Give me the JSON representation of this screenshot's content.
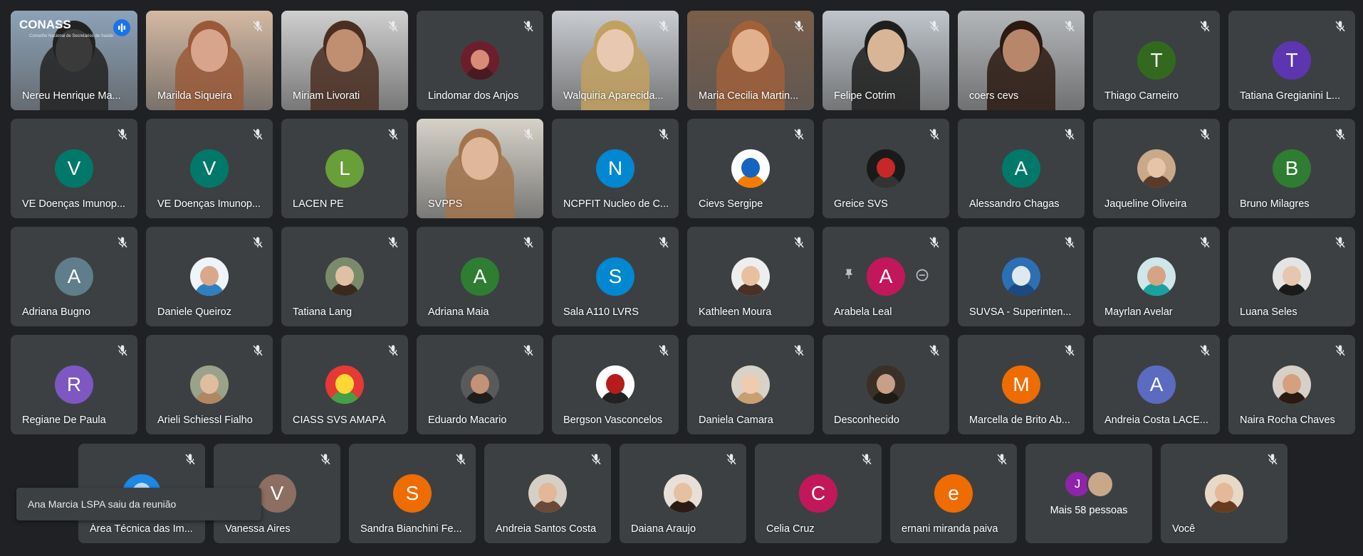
{
  "toast": "Ana Marcia LSPA saiu da reunião",
  "more_label": "Mais 58 pessoas",
  "conass": {
    "logo": "CONASS",
    "sub": "Conselho Nacional de Secretários de Saúde"
  },
  "participants": [
    {
      "name": "Nereu Henrique Ma...",
      "type": "video",
      "bg": "#8da2b8",
      "skin": "#3a3a3a",
      "hair": "#222",
      "active": true
    },
    {
      "name": "Marilda Siqueira",
      "type": "video",
      "bg": "#d4b9a3",
      "skin": "#d8a58c",
      "hair": "#9a5a3a"
    },
    {
      "name": "Miriam Livorati",
      "type": "video",
      "bg": "#cfcfcf",
      "skin": "#c08f72",
      "hair": "#4a2e22"
    },
    {
      "name": "Lindomar dos Anjos",
      "type": "photo",
      "c1": "#6c1e2d",
      "c2": "#d98b7a",
      "c3": "#4a1a22"
    },
    {
      "name": "Walquiria Aparecida...",
      "type": "video",
      "bg": "#c9ccd1",
      "skin": "#e8c8b0",
      "hair": "#c2a060"
    },
    {
      "name": "Maria Cecilia Martin...",
      "type": "video",
      "bg": "#7a5e4a",
      "skin": "#e3b08e",
      "hair": "#a0603a"
    },
    {
      "name": "Felipe Cotrim",
      "type": "video",
      "bg": "#bfc5cb",
      "skin": "#d9b597",
      "hair": "#1e1e1e"
    },
    {
      "name": "coers cevs",
      "type": "video",
      "bg": "#b4b7ba",
      "skin": "#b8866a",
      "hair": "#2b1a12"
    },
    {
      "name": "Thiago Carneiro",
      "type": "letter",
      "letter": "T",
      "color": "#33691e"
    },
    {
      "name": "Tatiana Gregianini L...",
      "type": "letter",
      "letter": "T",
      "color": "#5e35b1"
    },
    {
      "name": "VE Doenças Imunop...",
      "type": "letter",
      "letter": "V",
      "color": "#00796b"
    },
    {
      "name": "VE Doenças Imunop...",
      "type": "letter",
      "letter": "V",
      "color": "#00796b"
    },
    {
      "name": "LACEN PE",
      "type": "letter",
      "letter": "L",
      "color": "#689f38"
    },
    {
      "name": "SVPPS",
      "type": "video",
      "bg": "#d6d2c8",
      "skin": "#e0b79a",
      "hair": "#a3744e"
    },
    {
      "name": "NCPFIT Nucleo de C...",
      "type": "letter",
      "letter": "N",
      "color": "#0288d1"
    },
    {
      "name": "Cievs Sergipe",
      "type": "photo",
      "c1": "#ffffff",
      "c2": "#1565c0",
      "c3": "#f57c00"
    },
    {
      "name": "Greice SVS",
      "type": "photo",
      "c1": "#1a1a1a",
      "c2": "#c62828",
      "c3": "#333"
    },
    {
      "name": "Alessandro Chagas",
      "type": "letter",
      "letter": "A",
      "color": "#00796b"
    },
    {
      "name": "Jaqueline Oliveira",
      "type": "photo",
      "c1": "#c9a98a",
      "c2": "#e6c4a8",
      "c3": "#5a3a2a"
    },
    {
      "name": "Bruno Milagres",
      "type": "letter",
      "letter": "B",
      "color": "#2e7d32"
    },
    {
      "name": "Adriana Bugno",
      "type": "letter",
      "letter": "A",
      "color": "#607d8b"
    },
    {
      "name": "Daniele Queiroz",
      "type": "photo",
      "c1": "#eef4fa",
      "c2": "#d9a88a",
      "c3": "#2f7fc1"
    },
    {
      "name": "Tatiana Lang",
      "type": "photo",
      "c1": "#7c8a6c",
      "c2": "#e0c0a4",
      "c3": "#3a2a1e"
    },
    {
      "name": "Adriana Maia",
      "type": "letter",
      "letter": "A",
      "color": "#2e7d32"
    },
    {
      "name": "Sala A110 LVRS",
      "type": "letter",
      "letter": "S",
      "color": "#0288d1"
    },
    {
      "name": "Kathleen Moura",
      "type": "photo",
      "c1": "#eeeeee",
      "c2": "#e8c0a0",
      "c3": "#4a3026"
    },
    {
      "name": "Arabela Leal",
      "type": "letter",
      "letter": "A",
      "color": "#c2185b",
      "hover": true
    },
    {
      "name": "SUVSA - Superinten...",
      "type": "photo",
      "c1": "#2d6fb3",
      "c2": "#dfe7ef",
      "c3": "#1a4a80"
    },
    {
      "name": "Mayrlan Avelar",
      "type": "photo",
      "c1": "#cfe6ea",
      "c2": "#d6a484",
      "c3": "#16a3a0"
    },
    {
      "name": "Luana Seles",
      "type": "photo",
      "c1": "#e4e4e4",
      "c2": "#e6c6ae",
      "c3": "#1a1a1a"
    },
    {
      "name": "Regiane De Paula",
      "type": "letter",
      "letter": "R",
      "color": "#7e57c2"
    },
    {
      "name": "Arieli Schiessl Fialho",
      "type": "photo",
      "c1": "#9aa28a",
      "c2": "#e0bca0",
      "c3": "#b08860"
    },
    {
      "name": "CIASS SVS AMAPÁ",
      "type": "photo",
      "c1": "#e53935",
      "c2": "#fdd835",
      "c3": "#43a047"
    },
    {
      "name": "Eduardo Macario",
      "type": "photo",
      "c1": "#5a5a5a",
      "c2": "#c49274",
      "c3": "#1e1e1e"
    },
    {
      "name": "Bergson Vasconcelos",
      "type": "photo",
      "c1": "#ffffff",
      "c2": "#b71c1c",
      "c3": "#222"
    },
    {
      "name": "Daniela Camara",
      "type": "photo",
      "c1": "#d8d2c8",
      "c2": "#f0cbb0",
      "c3": "#c8a070"
    },
    {
      "name": "Desconhecido",
      "type": "photo",
      "c1": "#3a3028",
      "c2": "#c8a088",
      "c3": "#1e1a16"
    },
    {
      "name": "Marcella de Brito Ab...",
      "type": "letter",
      "letter": "M",
      "color": "#ef6c00"
    },
    {
      "name": "Andreia Costa LACE...",
      "type": "letter",
      "letter": "A",
      "color": "#5c6bc0"
    },
    {
      "name": "Naira Rocha Chaves",
      "type": "photo",
      "c1": "#d8d0c8",
      "c2": "#d4a080",
      "c3": "#2a1a12"
    },
    {
      "name": "Área Técnica das Im...",
      "type": "photo",
      "c1": "#1e88e5",
      "c2": "#bbdefb",
      "c3": "#0d47a1"
    },
    {
      "name": "Vanessa Aires",
      "type": "letter",
      "letter": "V",
      "color": "#8d6e63"
    },
    {
      "name": "Sandra Bianchini Fe...",
      "type": "letter",
      "letter": "S",
      "color": "#ef6c00"
    },
    {
      "name": "Andreia Santos Costa",
      "type": "photo",
      "c1": "#d6cfc6",
      "c2": "#e2b898",
      "c3": "#6a4a36"
    },
    {
      "name": "Daiana Araujo",
      "type": "photo",
      "c1": "#e8e0d8",
      "c2": "#e6c0a2",
      "c3": "#2a1c14"
    },
    {
      "name": "Celia Cruz",
      "type": "letter",
      "letter": "C",
      "color": "#c2185b"
    },
    {
      "name": "ernani miranda paiva",
      "type": "letter",
      "letter": "e",
      "color": "#ef6c00"
    },
    {
      "name": "",
      "type": "more",
      "letter": "J",
      "color": "#8e24aa"
    },
    {
      "name": "Você",
      "type": "photo",
      "c1": "#e8d8c8",
      "c2": "#e4b898",
      "c3": "#6a3a1e"
    }
  ]
}
